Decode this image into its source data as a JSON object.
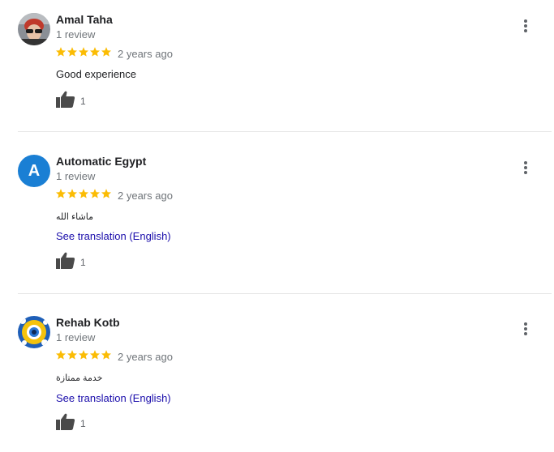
{
  "reviews": [
    {
      "name": "Amal Taha",
      "count": "1 review",
      "date": "2 years ago",
      "text": "Good experience",
      "likes": "1",
      "rating": 5,
      "avatar_icon": "profile-photo-icon"
    },
    {
      "name": "Automatic Egypt",
      "avatar_letter": "A",
      "count": "1 review",
      "date": "2 years ago",
      "text": "ماشاء الله",
      "translate": "See translation (English)",
      "likes": "1",
      "rating": 5
    },
    {
      "name": "Rehab Kotb",
      "count": "1 review",
      "date": "2 years ago",
      "text": "خدمة ممتازة",
      "translate": "See translation (English)",
      "likes": "1",
      "rating": 5,
      "avatar_icon": "profile-photo-icon"
    }
  ],
  "colors": {
    "star": "#fbbc04",
    "link": "#1a0dab",
    "avatar_letter_bg": "#1a7fd4",
    "secondary_text": "#70757a"
  },
  "icons": {
    "like": "thumbs-up-icon",
    "menu": "more-vert-icon",
    "star": "star-icon"
  }
}
